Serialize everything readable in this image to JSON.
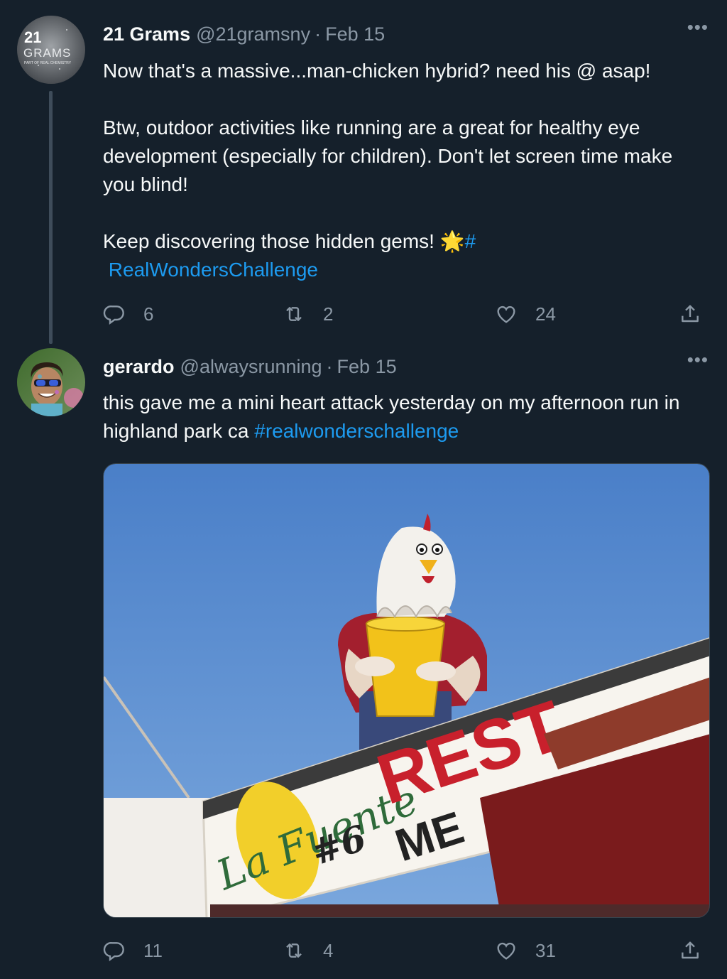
{
  "tweets": [
    {
      "display_name": "21 Grams",
      "handle": "@21gramsny",
      "separator": "·",
      "date": "Feb 15",
      "more": "•••",
      "avatar_text": {
        "number": "21",
        "word": "GRAMS",
        "tagline": "PART OF REAL CHEMISTRY"
      },
      "text_1": "Now that's a massive...man-chicken hybrid? need his @ asap!\n\nBtw, outdoor activities like running are a great for healthy eye development (especially for children). Don't let screen time make you blind!\n\nKeep discovering those hidden gems! ",
      "emoji": "🌟",
      "hashtag": "#\n RealWondersChallenge",
      "reply_count": "6",
      "retweet_count": "2",
      "like_count": "24"
    },
    {
      "display_name": "gerardo",
      "handle": "@alwaysrunning",
      "separator": "·",
      "date": "Feb 15",
      "more": "•••",
      "text_1": "this gave me a mini heart attack yesterday on my afternoon run in highland park ca ",
      "hashtag": "#realwonderschallenge",
      "reply_count": "11",
      "retweet_count": "4",
      "like_count": "31",
      "photo_sign": {
        "script": "La Fuente",
        "number": "#6",
        "word_1": "REST",
        "word_2": "ME"
      }
    }
  ],
  "colors": {
    "background": "#15202b",
    "text": "#f7f9f9",
    "muted": "#8b98a5",
    "accent": "#1d9bf0"
  },
  "icons": [
    "reply-icon",
    "retweet-icon",
    "like-icon",
    "share-icon",
    "more-icon"
  ]
}
